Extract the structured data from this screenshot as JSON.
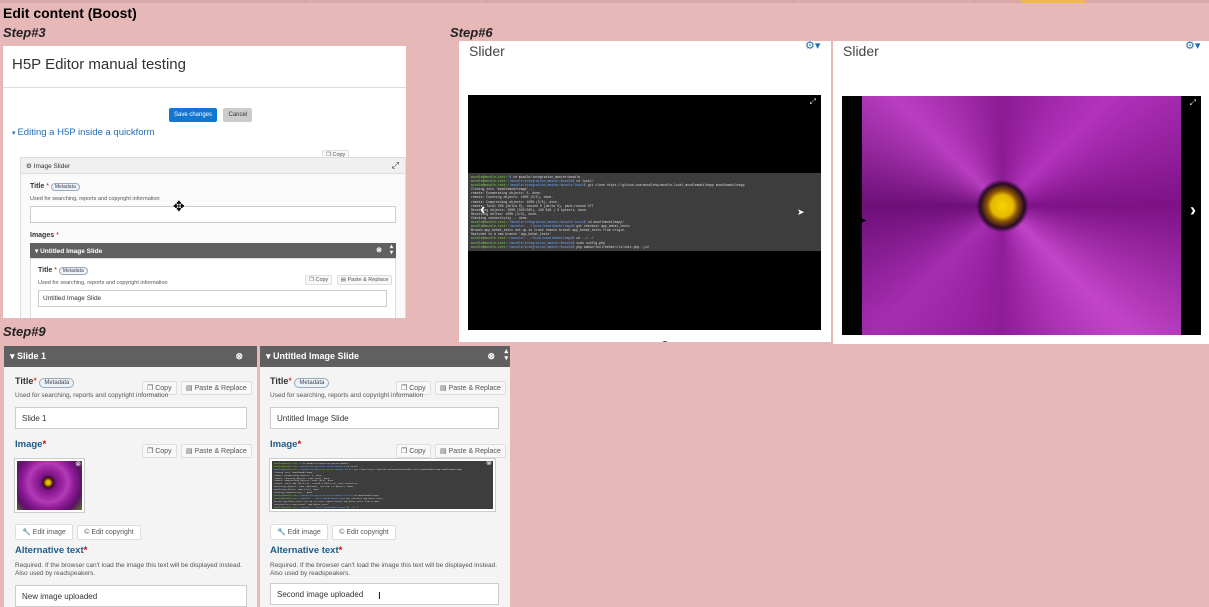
{
  "page": {
    "heading": "Edit content (Boost)",
    "steps": [
      "Step#3",
      "Step#6",
      "Step#9"
    ]
  },
  "step3": {
    "page_title": "H5P Editor manual testing",
    "save_label": "Save changes",
    "cancel_label": "Cancel",
    "section_title": "Editing a H5P inside a quickform",
    "copy_label": "Copy",
    "paste_label": "Paste & Replace",
    "widget_title": "Image Slider",
    "title_label": "Title",
    "metadata_label": "Metadata",
    "title_desc": "Used for searching, reports and copyright information",
    "title_value": "",
    "images_label": "Images",
    "slide_bar_title": "Untitled Image Slide",
    "slide_title_label": "Title",
    "slide_title_desc": "Used for searching, reports and copyright information",
    "slide_title_value": "Untitled Image Slide"
  },
  "step6": {
    "slider_title_left": "Slider",
    "slider_title_right": "Slider",
    "terminal_lines": [
      "moodle@moodle-test:~$ cd moodle/integration_master/moodle",
      "moodle@moodle-test:~/moodle/integration_master/moodle$ cd local/",
      "moodle@moodle-test:~/moodle/integration_master/moodle/local$ git clone https://github.com/moodlehq/moodle-local_moodlemobileapp moodlemobileapp",
      "Cloning into 'moodlemobileapp'...",
      "remote: Enumerating objects: 5, done.",
      "remote: Counting objects: 100% (5/5), done.",
      "remote: Compressing objects: 100% (5/5), done.",
      "remote: Total 500 (delta 0), reused 0 (delta 0), pack-reused 377",
      "Receiving objects: 100% (500/500), 126 KiB | 0 bytes/s, done.",
      "Resolving deltas: 100% (4/4), done.",
      "Checking connectivity... done.",
      "moodle@moodle-test:~/moodle/integration_master/moodle/local$ cd moodlemobileapp/",
      "moodle@moodle-test:~/moodle/.../local/moodlemobileapp$ git checkout app_behat_tests",
      "Branch app_behat_tests set up to track remote branch app_behat_tests from origin.",
      "Switched to a new branch 'app_behat_tests'",
      "moodle@moodle-test:~/moodle/.../local/moodlemobileapp$ cd ../../",
      "moodle@moodle-test:~/moodle/integration_master/moodle$ sudo config.php",
      "moodle@moodle-test:~/moodle/integration_master/moodle$ php admin/tool/behat/cli/init.php -j=2"
    ]
  },
  "step9": {
    "left": {
      "bar_title": "Slide 1",
      "title_label": "Title",
      "metadata_label": "Metadata",
      "copy_label": "Copy",
      "paste_label": "Paste & Replace",
      "title_desc": "Used for searching, reports and copyright information",
      "title_value": "Slide 1",
      "image_label": "Image",
      "edit_image_label": "Edit image",
      "edit_copyright_label": "Edit copyright",
      "alt_label": "Alternative text",
      "alt_desc": "Required. If the browser can't load the image this text will be displayed instead. Also used by readspeakers.",
      "alt_value": "New image uploaded"
    },
    "right": {
      "bar_title": "Untitled Image Slide",
      "title_label": "Title",
      "metadata_label": "Metadata",
      "copy_label": "Copy",
      "paste_label": "Paste & Replace",
      "title_desc": "Used for searching, reports and copyright information",
      "title_value": "Untitled Image Slide",
      "image_label": "Image",
      "edit_image_label": "Edit image",
      "edit_copyright_label": "Edit copyright",
      "alt_label": "Alternative text",
      "alt_desc": "Required. If the browser can't load the image this text will be displayed instead. Also used by readspeakers.",
      "alt_value": "Second image uploaded"
    }
  },
  "colors": {
    "background": "#e6b8b7",
    "accent": "#1e6db5",
    "save_button": "#1177d1",
    "bar": "#606060"
  }
}
